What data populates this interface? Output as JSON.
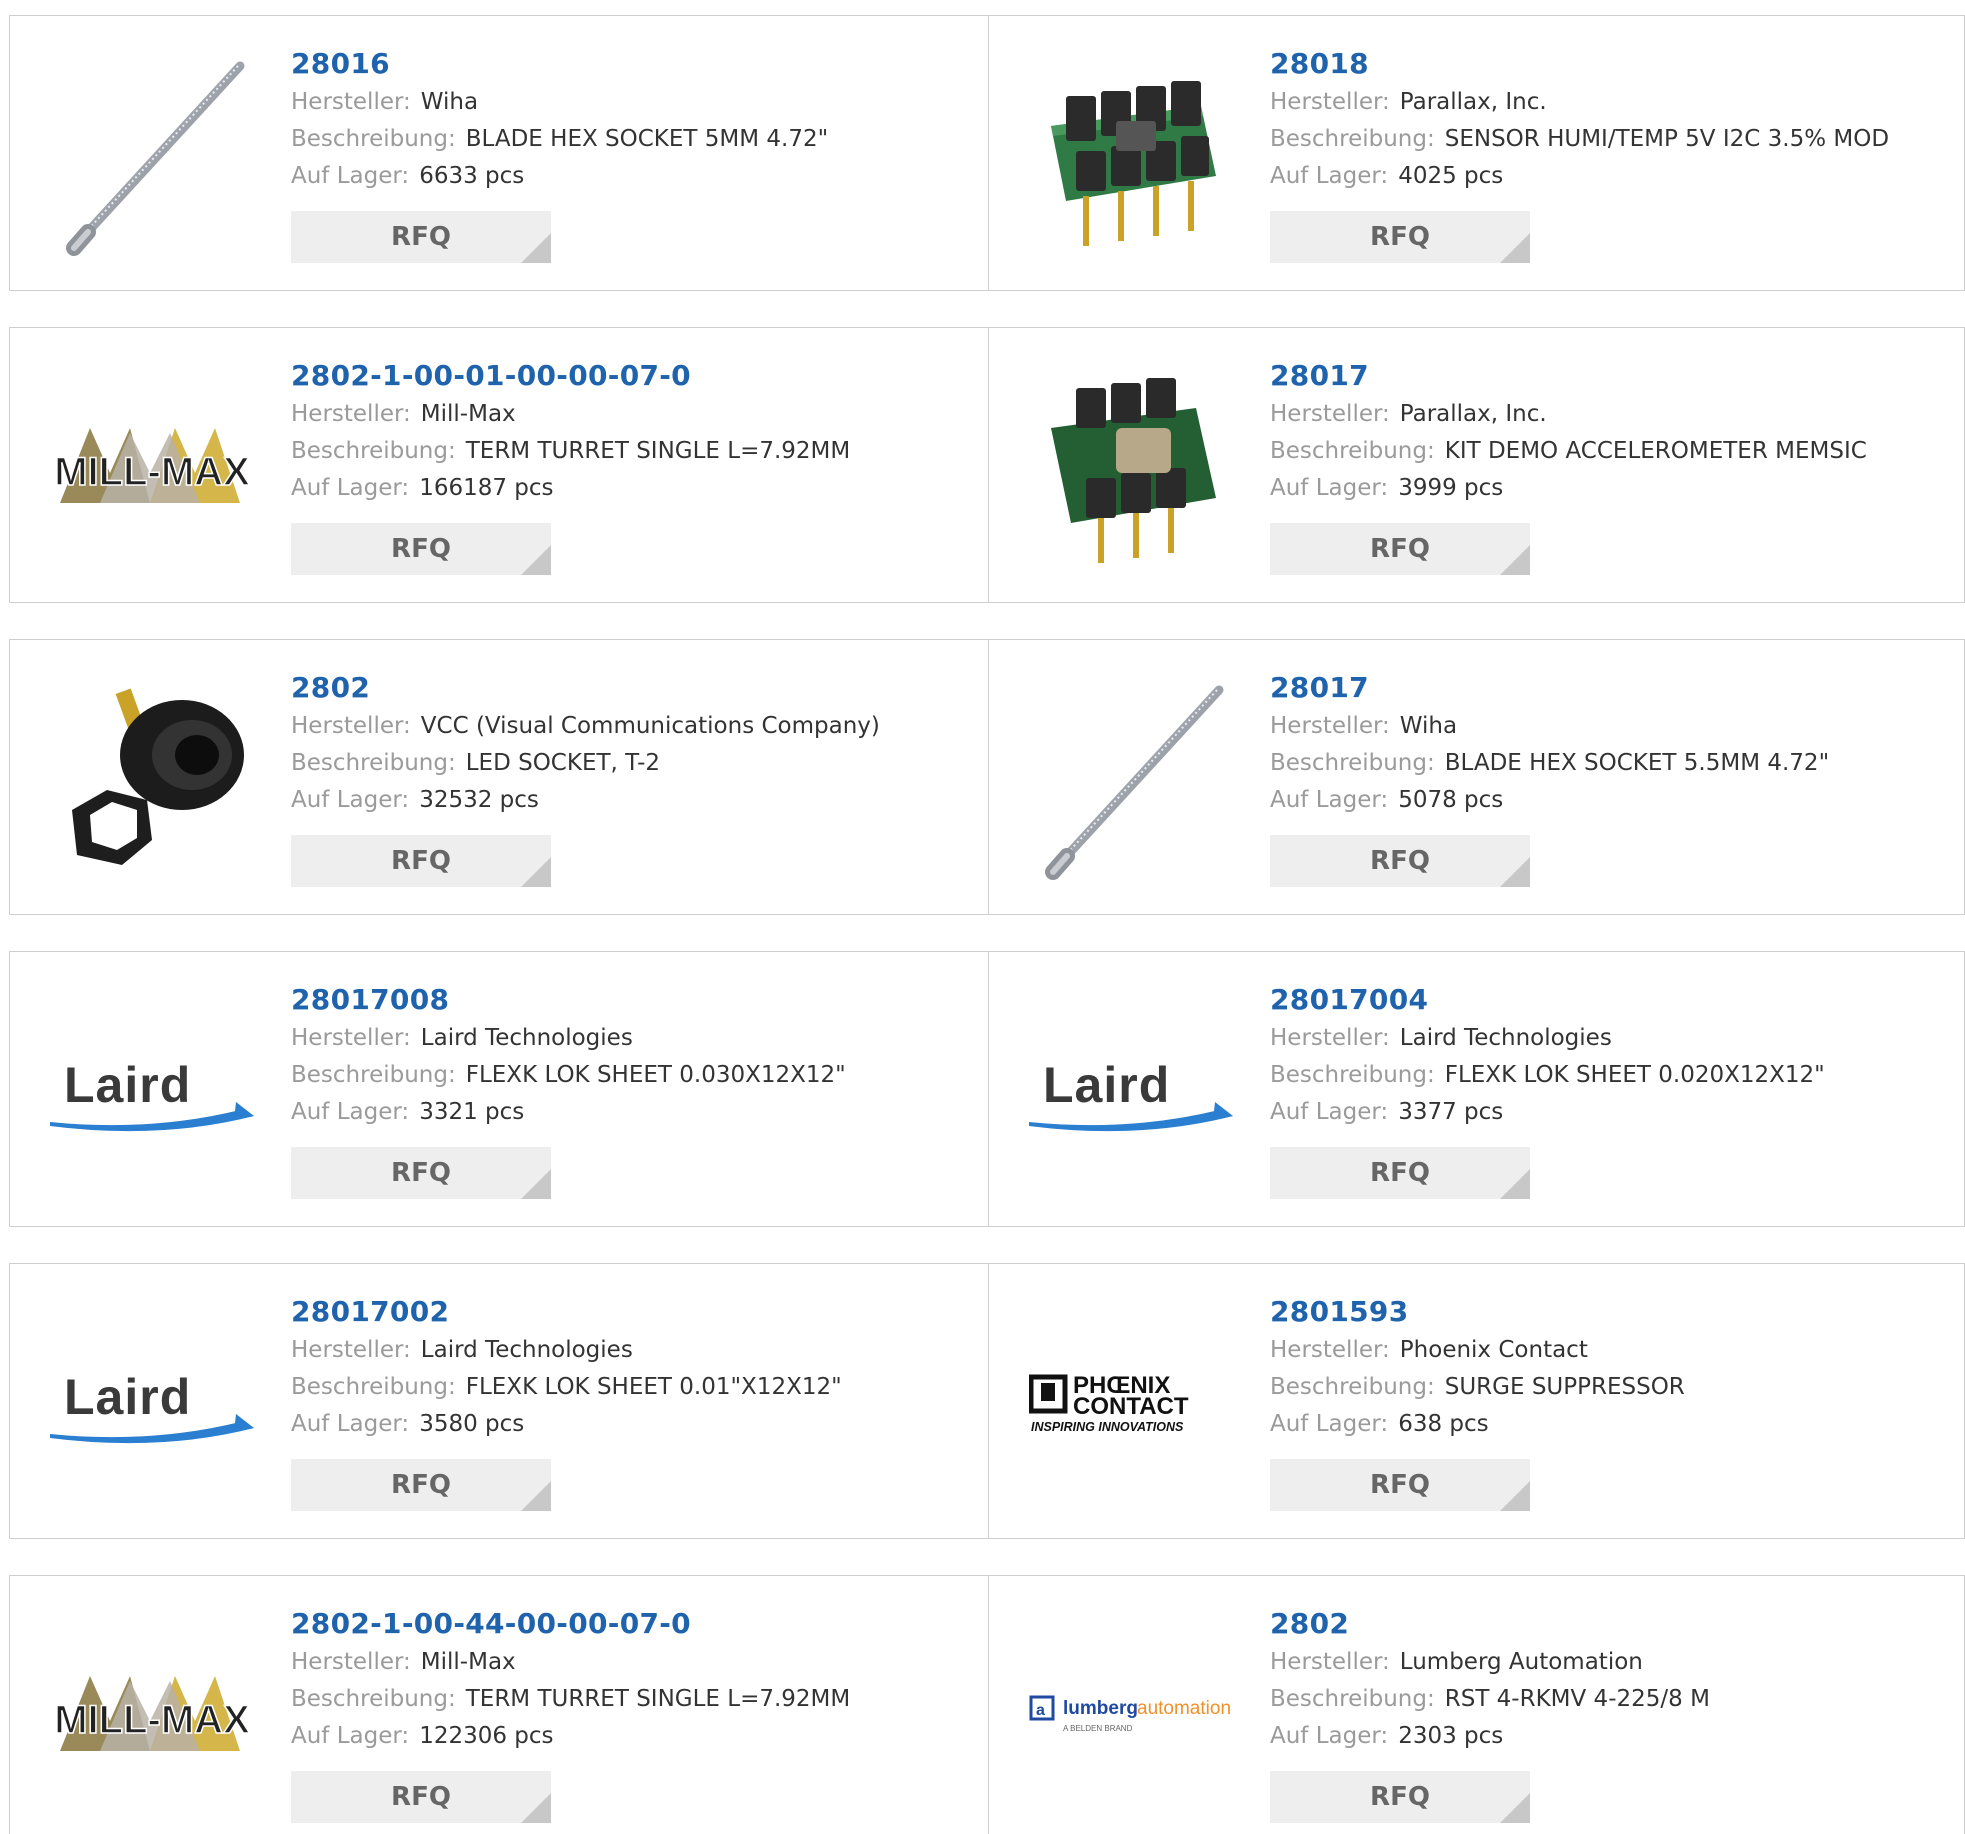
{
  "labels": {
    "manufacturer": "Hersteller:",
    "description": "Beschreibung:",
    "stock": "Auf Lager:",
    "rfq": "RFQ"
  },
  "products": [
    {
      "part": "28016",
      "manufacturer": "Wiha",
      "description": "BLADE HEX SOCKET 5MM 4.72\"",
      "stock": "6633 pcs",
      "image": "hex-blade-image"
    },
    {
      "part": "28018",
      "manufacturer": "Parallax, Inc.",
      "description": "SENSOR HUMI/TEMP 5V I2C 3.5% MOD",
      "stock": "4025 pcs",
      "image": "sensor-module-image"
    },
    {
      "part": "2802-1-00-01-00-00-07-0",
      "manufacturer": "Mill-Max",
      "description": "TERM TURRET SINGLE L=7.92MM",
      "stock": "166187 pcs",
      "image": "millmax-logo"
    },
    {
      "part": "28017",
      "manufacturer": "Parallax, Inc.",
      "description": "KIT DEMO ACCELEROMETER MEMSIC",
      "stock": "3999 pcs",
      "image": "accelerometer-module-image"
    },
    {
      "part": "2802",
      "manufacturer": "VCC (Visual Communications Company)",
      "description": "LED SOCKET, T-2",
      "stock": "32532 pcs",
      "image": "led-socket-image"
    },
    {
      "part": "28017",
      "manufacturer": "Wiha",
      "description": "BLADE HEX SOCKET 5.5MM 4.72\"",
      "stock": "5078 pcs",
      "image": "hex-blade-image"
    },
    {
      "part": "28017008",
      "manufacturer": "Laird Technologies",
      "description": "FLEXK LOK SHEET 0.030X12X12\"",
      "stock": "3321 pcs",
      "image": "laird-logo"
    },
    {
      "part": "28017004",
      "manufacturer": "Laird Technologies",
      "description": "FLEXK LOK SHEET 0.020X12X12\"",
      "stock": "3377 pcs",
      "image": "laird-logo"
    },
    {
      "part": "28017002",
      "manufacturer": "Laird Technologies",
      "description": "FLEXK LOK SHEET 0.01\"X12X12\"",
      "stock": "3580 pcs",
      "image": "laird-logo"
    },
    {
      "part": "2801593",
      "manufacturer": "Phoenix Contact",
      "description": "SURGE SUPPRESSOR",
      "stock": "638 pcs",
      "image": "phoenix-contact-logo"
    },
    {
      "part": "2802-1-00-44-00-00-07-0",
      "manufacturer": "Mill-Max",
      "description": "TERM TURRET SINGLE L=7.92MM",
      "stock": "122306 pcs",
      "image": "millmax-logo"
    },
    {
      "part": "2802",
      "manufacturer": "Lumberg Automation",
      "description": "RST 4-RKMV 4-225/8 M",
      "stock": "2303 pcs",
      "image": "lumberg-automation-logo"
    }
  ],
  "logos": {
    "laird": "Laird",
    "millmax": "MILL-MAX",
    "phoenix_line1": "PHŒNIX",
    "phoenix_line2": "CONTACT",
    "phoenix_tagline": "INSPIRING INNOVATIONS",
    "lumberg_a": "lumberg",
    "lumberg_b": "automation",
    "lumberg_c": "A BELDEN BRAND"
  },
  "colors": {
    "link": "#1f63ad",
    "label": "#9a9a9a",
    "button_bg": "#eeeeee",
    "border": "#cfcfcf"
  }
}
